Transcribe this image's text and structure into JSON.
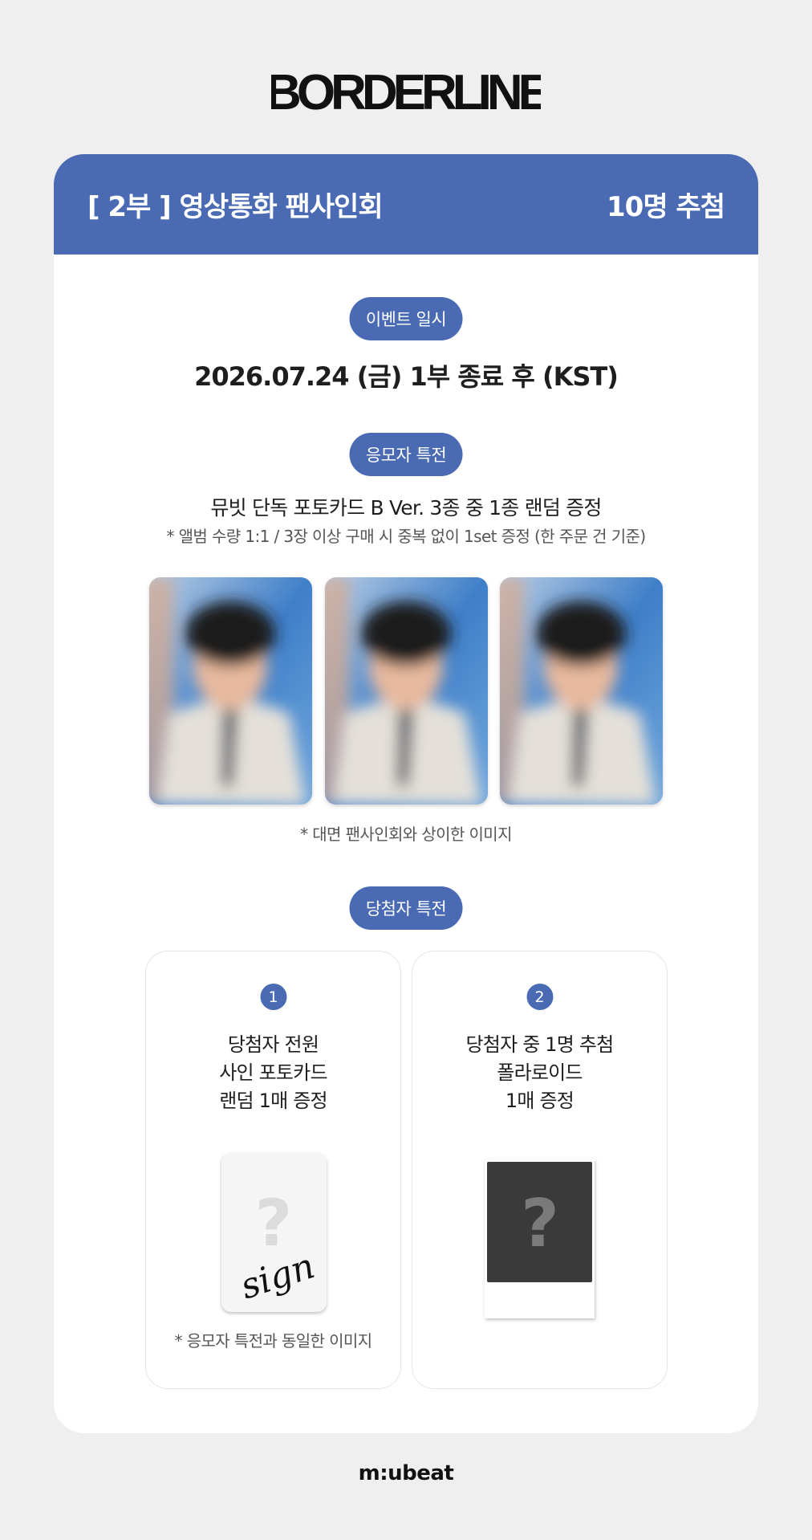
{
  "logo": {
    "text": "BORDERLINE"
  },
  "header": {
    "title": "[ 2부 ] 영상통화 팬사인회",
    "winners": "10명 추첨"
  },
  "event_date": {
    "label": "이벤트 일시",
    "value": "2026.07.24 (금) 1부 종료 후 (KST)"
  },
  "applicant_benefit": {
    "label": "응모자 특전",
    "title": "뮤빗 단독 포토카드 B Ver. 3종 중 1종 랜덤 증정",
    "note": "* 앨범 수량 1:1 / 3장 이상 구매 시 중복 없이 1set 증정 (한 주문 건 기준)",
    "image_note": "* 대면 팬사인회와 상이한 이미지"
  },
  "winner_benefit": {
    "label": "당첨자 특전",
    "items": [
      {
        "number": "1",
        "lines": [
          "당첨자 전원",
          "사인 포토카드",
          "랜덤 1매 증정"
        ],
        "image_note": "* 응모자 특전과 동일한 이미지",
        "image_text": "sign"
      },
      {
        "number": "2",
        "lines": [
          "당첨자 중 1명 추첨",
          "폴라로이드",
          "1매 증정"
        ]
      }
    ]
  },
  "footer": {
    "brand": "m:ubeat"
  },
  "colors": {
    "accent": "#4a6bb4",
    "background": "#efefef",
    "card": "#ffffff"
  }
}
